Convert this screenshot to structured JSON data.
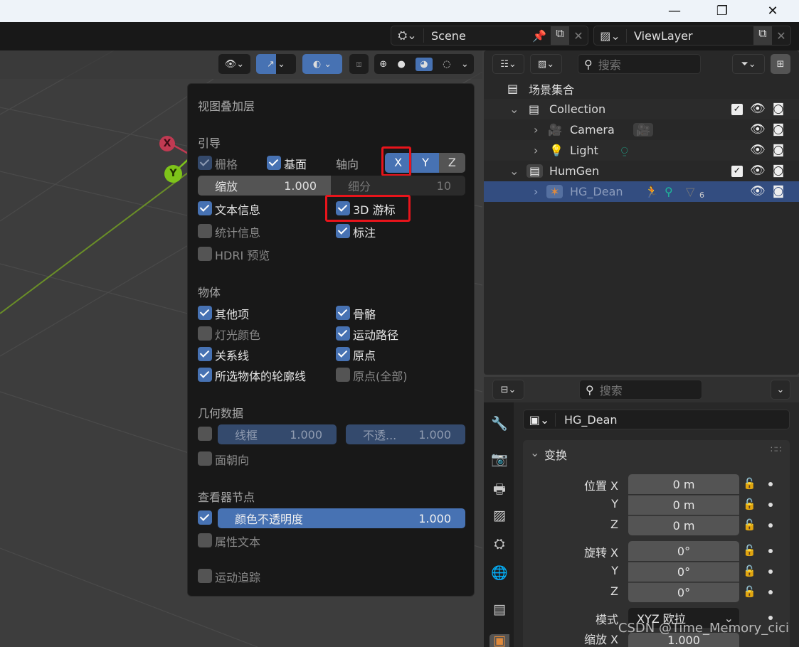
{
  "window": {
    "minimize": "—",
    "maximize": "❐",
    "close": "✕"
  },
  "topbar": {
    "scene": "Scene",
    "view_layer": "ViewLayer"
  },
  "overlay_popup": {
    "title": "视图叠加层",
    "guides": {
      "heading": "引导",
      "grid": "栅格",
      "floor": "基面",
      "axes": "轴向",
      "axis_x": "X",
      "axis_y": "Y",
      "axis_z": "Z",
      "scale_label": "缩放",
      "scale_value": "1.000",
      "subdiv_label": "细分",
      "subdiv_value": "10",
      "text_info": "文本信息",
      "cursor_3d": "3D 游标",
      "statistics": "统计信息",
      "annotations": "标注",
      "hdri_preview": "HDRI 预览",
      "checked": {
        "grid": true,
        "floor": true,
        "text_info": true,
        "cursor_3d": true,
        "statistics": false,
        "annotations": true,
        "hdri_preview": false
      }
    },
    "objects": {
      "heading": "物体",
      "extras": "其他项",
      "bones": "骨骼",
      "light_colors": "灯光颜色",
      "motion_paths": "运动路径",
      "relationship_lines": "关系线",
      "origins": "原点",
      "outline_selected": "所选物体的轮廓线",
      "origins_all": "原点(全部)"
    },
    "geometry": {
      "heading": "几何数据",
      "wireframe_label": "线框",
      "wireframe_value": "1.000",
      "opacity_label": "不透...",
      "opacity_value": "1.000",
      "face_orientation": "面朝向"
    },
    "viewer_node": {
      "heading": "查看器节点",
      "color_opacity_label": "颜色不透明度",
      "color_opacity_value": "1.000",
      "attribute_text": "属性文本"
    },
    "motion_tracking": "运动追踪"
  },
  "gizmo": {
    "x": "X",
    "y": "Y"
  },
  "outliner": {
    "search_placeholder": "搜索",
    "root": "场景集合",
    "items": [
      {
        "name": "Collection"
      },
      {
        "name": "Camera"
      },
      {
        "name": "Light"
      },
      {
        "name": "HumGen"
      },
      {
        "name": "HG_Dean",
        "badge": "6"
      }
    ]
  },
  "properties": {
    "search_placeholder": "搜索",
    "object_name": "HG_Dean",
    "panel_title": "变换",
    "location_label": "位置 X",
    "rotation_label": "旋转 X",
    "mode_label": "模式",
    "scale_label": "缩放 X",
    "y": "Y",
    "z": "Z",
    "location": [
      "0 m",
      "0 m",
      "0 m"
    ],
    "rotation": [
      "0°",
      "0°",
      "0°"
    ],
    "mode": "XYZ 欧拉",
    "scale_x": "1.000"
  },
  "watermark": "CSDN @Time_Memory_cici",
  "colors": {
    "accent": "#4772b3",
    "highlight": "#e8141b",
    "x_axis": "#c03a52",
    "y_axis": "#7ec41a",
    "selected_row": "#334d80"
  }
}
